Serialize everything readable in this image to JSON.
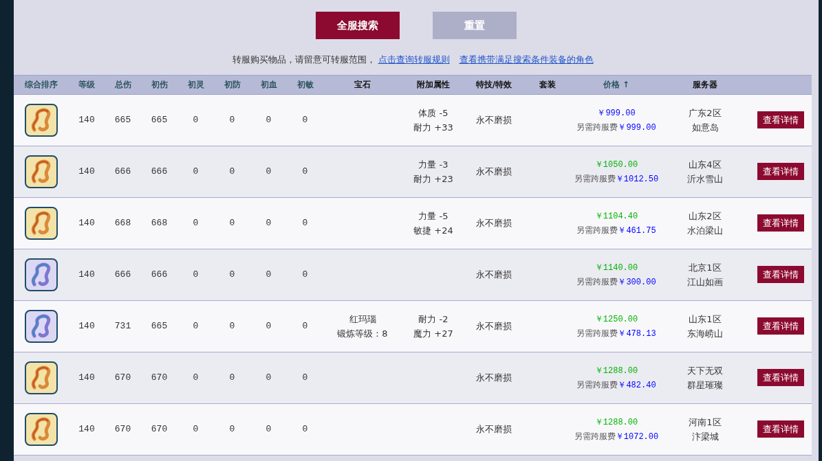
{
  "buttons": [
    {
      "label": "全服搜索",
      "kind": "primary"
    },
    {
      "label": "重置",
      "kind": "secondary"
    }
  ],
  "notice": {
    "text": "转服购买物品，请留意可转服范围，",
    "links": [
      "点击查询转服规则",
      "查看携带满足搜索条件装备的角色"
    ]
  },
  "table": {
    "columns": [
      {
        "label": "综合排序",
        "sortable": true
      },
      {
        "label": "等级",
        "sortable": true
      },
      {
        "label": "总伤",
        "sortable": true
      },
      {
        "label": "初伤",
        "sortable": true
      },
      {
        "label": "初灵",
        "sortable": true
      },
      {
        "label": "初防",
        "sortable": true
      },
      {
        "label": "初血",
        "sortable": true
      },
      {
        "label": "初敏",
        "sortable": true
      },
      {
        "label": "宝石",
        "sortable": false
      },
      {
        "label": "附加属性",
        "sortable": false
      },
      {
        "label": "特技/特效",
        "sortable": false
      },
      {
        "label": "套装",
        "sortable": false
      },
      {
        "label": "价格",
        "sortable": true,
        "sort_arrow": "↑"
      },
      {
        "label": "服务器",
        "sortable": false
      }
    ],
    "rows": [
      {
        "kind": "gold",
        "stats": [
          "140",
          "665",
          "665",
          "0",
          "0",
          "0",
          "0"
        ],
        "gem": [],
        "attrs": [
          "体质 -5",
          "耐力 +33"
        ],
        "special": "永不磨损",
        "price": "￥999.00",
        "color": "#0000ff",
        "fee_label": "另需跨服费",
        "fee": "￥999.00",
        "server": [
          "广东2区",
          "如意岛"
        ],
        "action": "查看详情"
      },
      {
        "kind": "gold",
        "stats": [
          "140",
          "666",
          "666",
          "0",
          "0",
          "0",
          "0"
        ],
        "gem": [],
        "attrs": [
          "力量 -3",
          "耐力 +23"
        ],
        "special": "永不磨损",
        "price": "￥1050.00",
        "color": "#00b400",
        "fee_label": "另需跨服费",
        "fee": "￥1012.50",
        "server": [
          "山东4区",
          "沂水雪山"
        ],
        "action": "查看详情"
      },
      {
        "kind": "gold",
        "stats": [
          "140",
          "668",
          "668",
          "0",
          "0",
          "0",
          "0"
        ],
        "gem": [],
        "attrs": [
          "力量 -5",
          "敏捷 +24"
        ],
        "special": "永不磨损",
        "price": "￥1104.40",
        "color": "#00b400",
        "fee_label": "另需跨服费",
        "fee": "￥461.75",
        "server": [
          "山东2区",
          "水泊梁山"
        ],
        "action": "查看详情"
      },
      {
        "kind": "blue",
        "stats": [
          "140",
          "666",
          "666",
          "0",
          "0",
          "0",
          "0"
        ],
        "gem": [],
        "attrs": [],
        "special": "永不磨损",
        "price": "￥1140.00",
        "color": "#00b400",
        "fee_label": "另需跨服费",
        "fee": "￥300.00",
        "server": [
          "北京1区",
          "江山如画"
        ],
        "action": "查看详情"
      },
      {
        "kind": "blue",
        "stats": [
          "140",
          "731",
          "665",
          "0",
          "0",
          "0",
          "0"
        ],
        "gem": [
          "红玛瑙",
          "锻炼等级：8"
        ],
        "attrs": [
          "耐力 -2",
          "魔力 +27"
        ],
        "special": "永不磨损",
        "price": "￥1250.00",
        "color": "#00b400",
        "fee_label": "另需跨服费",
        "fee": "￥478.13",
        "server": [
          "山东1区",
          "东海崂山"
        ],
        "action": "查看详情"
      },
      {
        "kind": "gold",
        "stats": [
          "140",
          "670",
          "670",
          "0",
          "0",
          "0",
          "0"
        ],
        "gem": [],
        "attrs": [],
        "special": "永不磨损",
        "price": "￥1288.00",
        "color": "#00b400",
        "fee_label": "另需跨服费",
        "fee": "￥482.40",
        "server": [
          "天下无双",
          "群星璀璨"
        ],
        "action": "查看详情"
      },
      {
        "kind": "gold",
        "stats": [
          "140",
          "670",
          "670",
          "0",
          "0",
          "0",
          "0"
        ],
        "gem": [],
        "attrs": [],
        "special": "永不磨损",
        "price": "￥1288.00",
        "color": "#00b400",
        "fee_label": "另需跨服费",
        "fee": "￥1072.00",
        "server": [
          "河南1区",
          "汴梁城"
        ],
        "action": "查看详情"
      }
    ]
  }
}
